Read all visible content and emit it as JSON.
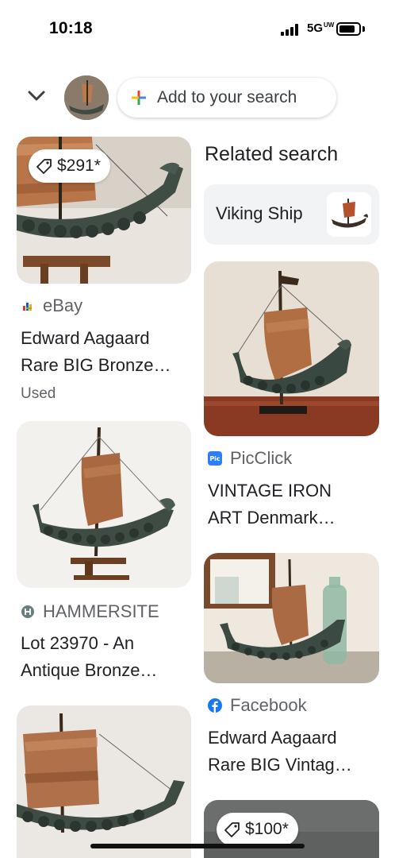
{
  "status_bar": {
    "time": "10:18",
    "network": "5G",
    "network_sup": "UW"
  },
  "search": {
    "add_label": "Add to your search"
  },
  "results_left": [
    {
      "price": "$291*",
      "source": "eBay",
      "title_lines": [
        "Edward Aagaard",
        "Rare BIG Bronze…"
      ],
      "condition": "Used"
    },
    {
      "source": "HAMMERSITE",
      "title_lines": [
        "Lot 23970 - An",
        "Antique Bronze…"
      ]
    },
    {
      "source": "",
      "title_lines": []
    }
  ],
  "related": {
    "heading": "Related search",
    "chip_label": "Viking Ship"
  },
  "results_right": [
    {
      "source": "PicClick",
      "title_lines": [
        "VINTAGE IRON",
        "ART Denmark…"
      ]
    },
    {
      "source": "Facebook",
      "title_lines": [
        "Edward Aagaard",
        "Rare BIG Vintag…"
      ]
    },
    {
      "price": "$100*"
    }
  ],
  "colors": {
    "ebay_blue": "#0064d2",
    "ebay_red": "#e53238",
    "ebay_yellow": "#f5af02",
    "ebay_green": "#86b817",
    "picclick_blue": "#2d7ff9",
    "facebook_blue": "#1877f2",
    "hammersite_gray": "#6b7d7d"
  }
}
